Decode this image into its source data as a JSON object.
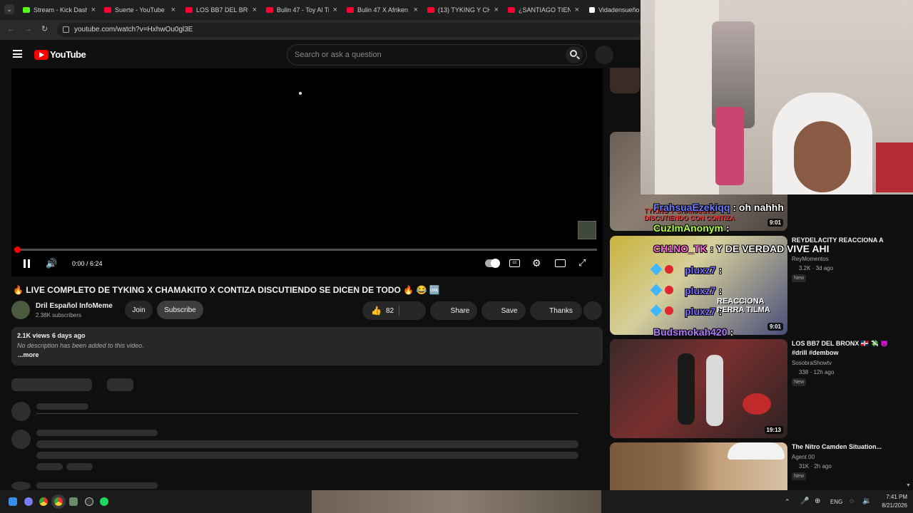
{
  "tabs": [
    {
      "label": "Stream - Kick Dash",
      "color": "#53fc18"
    },
    {
      "label": "Suerte - YouTube",
      "color": "#ff0033"
    },
    {
      "label": "LOS BB7 DEL BRONX",
      "color": "#ff0033"
    },
    {
      "label": "Bulin 47 - Toy Al Ti",
      "color": "#ff0033"
    },
    {
      "label": "Bulin 47 X Afriken",
      "color": "#ff0033"
    },
    {
      "label": "(13) TYKING Y CHA",
      "color": "#ff0033"
    },
    {
      "label": "¿SANTIAGO TIENE",
      "color": "#ff0033"
    },
    {
      "label": "Vidadensueño",
      "color": "#ffffff"
    }
  ],
  "address": {
    "url": "youtube.com/watch?v=HxhwOu0gl3E"
  },
  "youtube": {
    "logo_text": "YouTube",
    "search_placeholder": "Search or ask a question"
  },
  "player": {
    "time": "0:00 / 6:24",
    "progress_fraction": 0.0
  },
  "video": {
    "title": "🔥 LIVE COMPLETO DE TYKING X CHAMAKITO X CONTIZA DISCUTIENDO SE DICEN DE TODO 🔥 😂 🆒",
    "channel": "Dril Español InfoMeme",
    "subscribers": "2.38K subscribers",
    "join_label": "Join",
    "subscribe_label": "Subscribe",
    "likes": "82",
    "share_label": "Share",
    "save_label": "Save",
    "thanks_label": "Thanks",
    "views": "2.1K views",
    "age": "6 days ago",
    "description": "No description has been added to this video.",
    "more_label": "...more"
  },
  "sidebar": {
    "items": [
      {
        "duration": "9:01",
        "thumb_text": "TYKING Y CHAMAKITO DISCUTIENDO CON CONTIZA"
      },
      {
        "duration": "9:01",
        "thumb_text": "REACCIONA PERRA TILMA",
        "title": "REYDELACITY REACCIONA A",
        "channel": "ReyMomentos",
        "views": "3.2K",
        "age": "3d ago",
        "badge": "New"
      },
      {
        "duration": "19:13",
        "title": "LOS BB7 DEL BRONX 🇩🇴 💸 👿 #drill #dembow",
        "channel": "SosobraShowtv",
        "views": "338",
        "age": "12h ago",
        "badge": "New"
      },
      {
        "title": "The Nitro Camden Situation...",
        "channel": "Agent 00",
        "views": "31K",
        "age": "2h ago",
        "badge": "New"
      }
    ]
  },
  "chat": [
    {
      "name": "FrahsuaEzekiqq",
      "text": ": oh nahhh",
      "color": "#6d7cff"
    },
    {
      "name": "CuzImAnonym",
      "text": ":",
      "color": "#b3ff3f"
    },
    {
      "name": "CH1NO_TK",
      "text": ": Y DE VERDAD VIVE AHI",
      "color": "#ff66e0"
    },
    {
      "name": "pluxz7",
      "text": ":",
      "color": "#7b6dff"
    },
    {
      "name": "pluxz7",
      "text": ":",
      "color": "#7b6dff"
    },
    {
      "name": "pluxz7",
      "text": ":",
      "color": "#7b6dff"
    },
    {
      "name": "Budsmokah420",
      "text": ":",
      "color": "#b07cff"
    }
  ],
  "taskbar": {
    "lang": "ENG",
    "time": "7:41 PM",
    "date": "8/21/2026"
  }
}
